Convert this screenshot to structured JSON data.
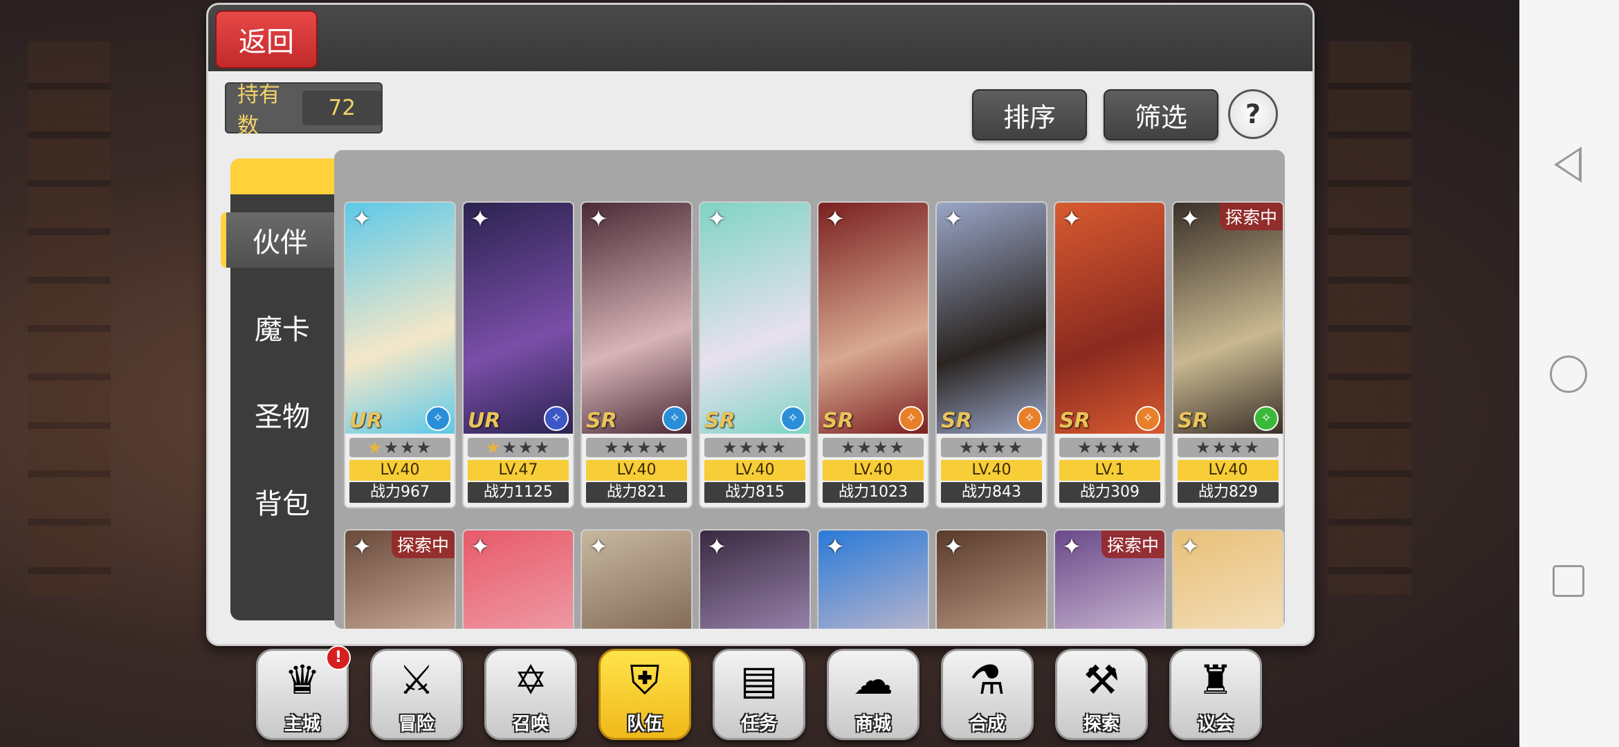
{
  "header": {
    "back_label": "返回"
  },
  "owned": {
    "label": "持有数",
    "value": "72"
  },
  "toolbar": {
    "sort_label": "排序",
    "filter_label": "筛选",
    "help_label": "?"
  },
  "tabs": [
    {
      "label": "伙伴",
      "active": true
    },
    {
      "label": "魔卡",
      "active": false
    },
    {
      "label": "圣物",
      "active": false
    },
    {
      "label": "背包",
      "active": false
    }
  ],
  "explore_tag": "探索中",
  "row1": [
    {
      "rarity": "UR",
      "stars_gold": 1,
      "stars_total": 4,
      "level": "LV.40",
      "power": "战力967",
      "class_color": "#2a8fd8",
      "exploring": false,
      "art": [
        "#5ec9e8",
        "#f4e7c8"
      ]
    },
    {
      "rarity": "UR",
      "stars_gold": 1,
      "stars_total": 4,
      "level": "LV.47",
      "power": "战力1125",
      "class_color": "#3d57c8",
      "exploring": false,
      "art": [
        "#2b2350",
        "#7a4ea8"
      ]
    },
    {
      "rarity": "SR",
      "stars_gold": 0,
      "stars_total": 4,
      "level": "LV.40",
      "power": "战力821",
      "class_color": "#2a8fd8",
      "exploring": false,
      "art": [
        "#4a2a35",
        "#d7b4b8"
      ]
    },
    {
      "rarity": "SR",
      "stars_gold": 0,
      "stars_total": 4,
      "level": "LV.40",
      "power": "战力815",
      "class_color": "#2a8fd8",
      "exploring": false,
      "art": [
        "#7fd4c4",
        "#e8e0f0"
      ]
    },
    {
      "rarity": "SR",
      "stars_gold": 0,
      "stars_total": 4,
      "level": "LV.40",
      "power": "战力1023",
      "class_color": "#e8802a",
      "exploring": false,
      "art": [
        "#7a2020",
        "#d8a890"
      ]
    },
    {
      "rarity": "SR",
      "stars_gold": 0,
      "stars_total": 4,
      "level": "LV.40",
      "power": "战力843",
      "class_color": "#e8802a",
      "exploring": false,
      "art": [
        "#9aa6c8",
        "#2a2420"
      ]
    },
    {
      "rarity": "SR",
      "stars_gold": 0,
      "stars_total": 4,
      "level": "LV.1",
      "power": "战力309",
      "class_color": "#e8802a",
      "exploring": false,
      "art": [
        "#d85a30",
        "#8a2a20"
      ]
    },
    {
      "rarity": "SR",
      "stars_gold": 0,
      "stars_total": 4,
      "level": "LV.40",
      "power": "战力829",
      "class_color": "#3ab83a",
      "exploring": true,
      "art": [
        "#3a3028",
        "#c8b890"
      ]
    }
  ],
  "row2": [
    {
      "exploring": true,
      "art": [
        "#6a4a3a",
        "#e8c8b8"
      ]
    },
    {
      "exploring": false,
      "art": [
        "#e85a6a",
        "#f0b0b8"
      ]
    },
    {
      "exploring": false,
      "art": [
        "#c8b8a0",
        "#6a5040"
      ]
    },
    {
      "exploring": false,
      "art": [
        "#3a2a40",
        "#b8a0d0"
      ]
    },
    {
      "exploring": false,
      "art": [
        "#2a7ad8",
        "#e8c8c8"
      ]
    },
    {
      "exploring": false,
      "art": [
        "#5a3a2a",
        "#d8b8a0"
      ]
    },
    {
      "exploring": true,
      "art": [
        "#6a4a8a",
        "#e8d8e8"
      ]
    },
    {
      "exploring": false,
      "art": [
        "#e8c078",
        "#f8e8d0"
      ]
    }
  ],
  "menu": [
    {
      "label": "主城",
      "glyph": "♛",
      "active": false,
      "badge": "!"
    },
    {
      "label": "冒险",
      "glyph": "⚔",
      "active": false,
      "badge": ""
    },
    {
      "label": "召唤",
      "glyph": "✡",
      "active": false,
      "badge": ""
    },
    {
      "label": "队伍",
      "glyph": "⛨",
      "active": true,
      "badge": ""
    },
    {
      "label": "任务",
      "glyph": "▤",
      "active": false,
      "badge": ""
    },
    {
      "label": "商城",
      "glyph": "☁",
      "active": false,
      "badge": ""
    },
    {
      "label": "合成",
      "glyph": "⚗",
      "active": false,
      "badge": ""
    },
    {
      "label": "探索",
      "glyph": "⚒",
      "active": false,
      "badge": ""
    },
    {
      "label": "议会",
      "glyph": "♜",
      "active": false,
      "badge": ""
    }
  ]
}
